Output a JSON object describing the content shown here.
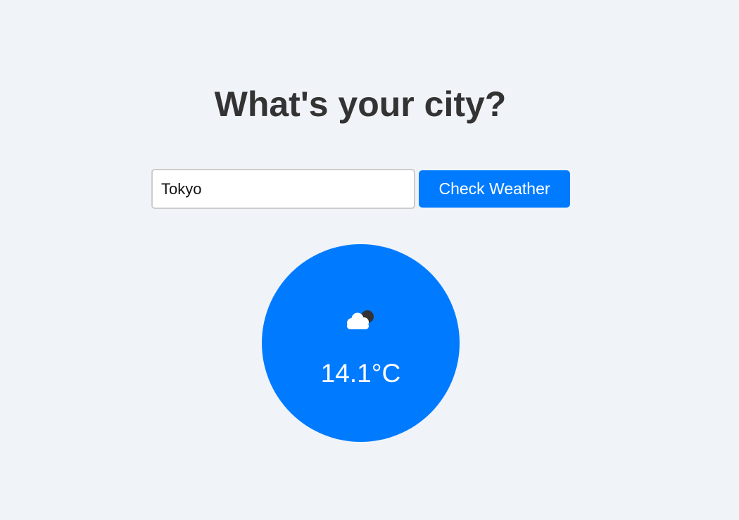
{
  "header": {
    "title": "What's your city?"
  },
  "search": {
    "value": "Tokyo",
    "button_label": "Check Weather"
  },
  "weather": {
    "icon": "cloud-with-moon-icon",
    "temperature": "14.1°C"
  },
  "colors": {
    "background": "#f0f3f8",
    "accent": "#007bff",
    "title": "#333333"
  }
}
